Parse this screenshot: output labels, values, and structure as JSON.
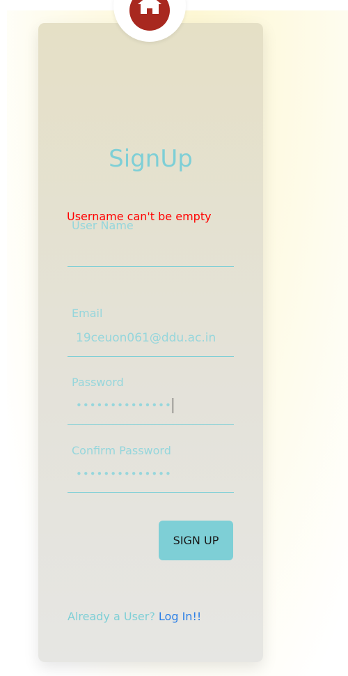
{
  "form": {
    "title": "SignUp",
    "error_message": "Username can't be empty",
    "fields": {
      "username": {
        "label": "User Name",
        "value": ""
      },
      "email": {
        "label": "Email",
        "value": "19ceuon061@ddu.ac.in"
      },
      "password": {
        "label": "Password",
        "value": "••••••••••••••"
      },
      "confirm_password": {
        "label": "Confirm Password",
        "value": "••••••••••••••"
      }
    },
    "submit_label": "SIGN UP",
    "login_prompt": "Already a User?",
    "login_link": "Log In!!"
  },
  "colors": {
    "accent": "#7ecfd6",
    "error": "#ff0000",
    "link": "#2b7fe6",
    "logo": "#a8281f"
  },
  "icons": {
    "logo": "house-icon"
  }
}
